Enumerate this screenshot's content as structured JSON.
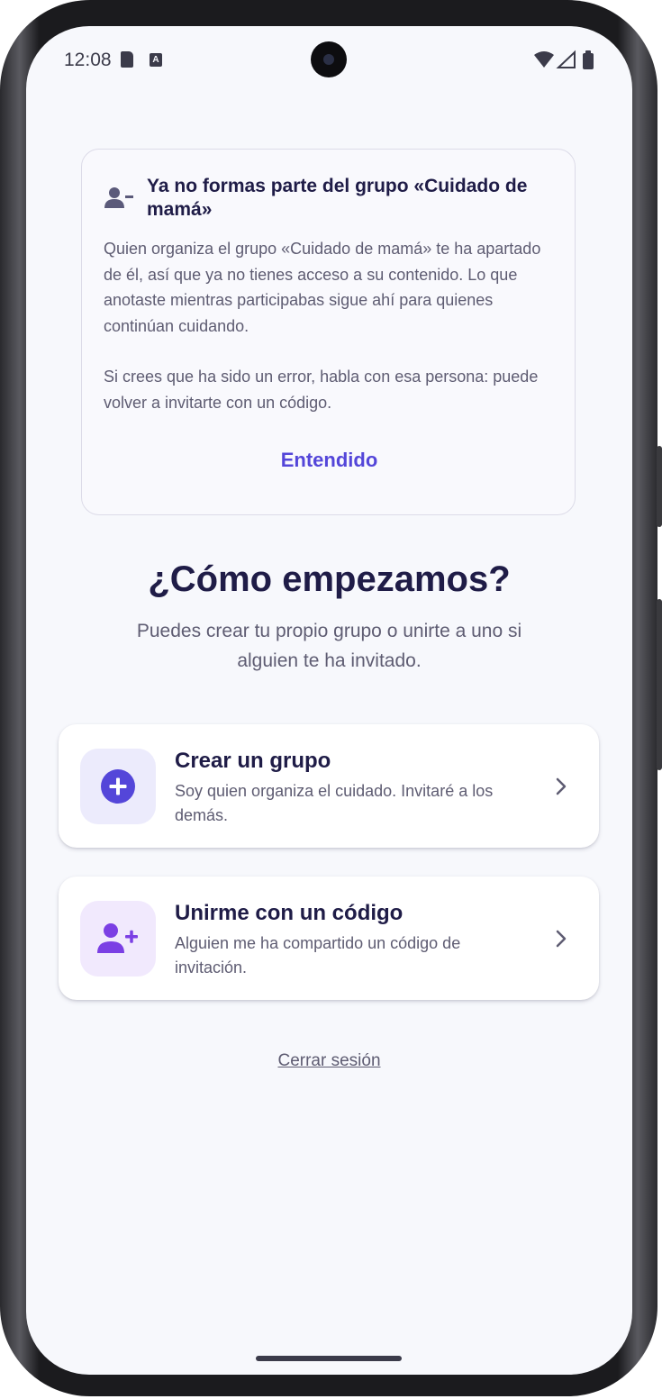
{
  "status_bar": {
    "time": "12:08",
    "left_icons": [
      "sd-card-icon",
      "keyboard-a-icon"
    ],
    "right_icons": [
      "wifi-icon",
      "signal-icon",
      "battery-icon"
    ]
  },
  "notice": {
    "icon": "person-remove-icon",
    "title": "Ya no formas parte del grupo «Cuidado de mamá»",
    "paragraph_1": "Quien organiza el grupo «Cuidado de mamá» te ha apartado de él, así que ya no tienes acceso a su contenido. Lo que anotaste mientras participabas sigue ahí para quienes continúan cuidando.",
    "paragraph_2": "Si crees que ha sido un error, habla con esa persona: puede volver a invitarte con un código.",
    "button_label": "Entendido"
  },
  "main": {
    "heading": "¿Cómo empezamos?",
    "subheading": "Puedes crear tu propio grupo o unirte a uno si alguien te ha invitado.",
    "options": [
      {
        "icon": "plus-circle-icon",
        "title": "Crear un grupo",
        "description": "Soy quien organiza el cuidado. Invitaré a los demás."
      },
      {
        "icon": "person-add-icon",
        "title": "Unirme con un código",
        "description": "Alguien me ha compartido un código de invitación."
      }
    ],
    "logout_label": "Cerrar sesión"
  },
  "colors": {
    "accent": "#5446d9",
    "accent_purple": "#7b3fe4",
    "text_dark": "#1f1c47",
    "text_muted": "#5e5c72",
    "screen_background": "#f7f8fc"
  }
}
